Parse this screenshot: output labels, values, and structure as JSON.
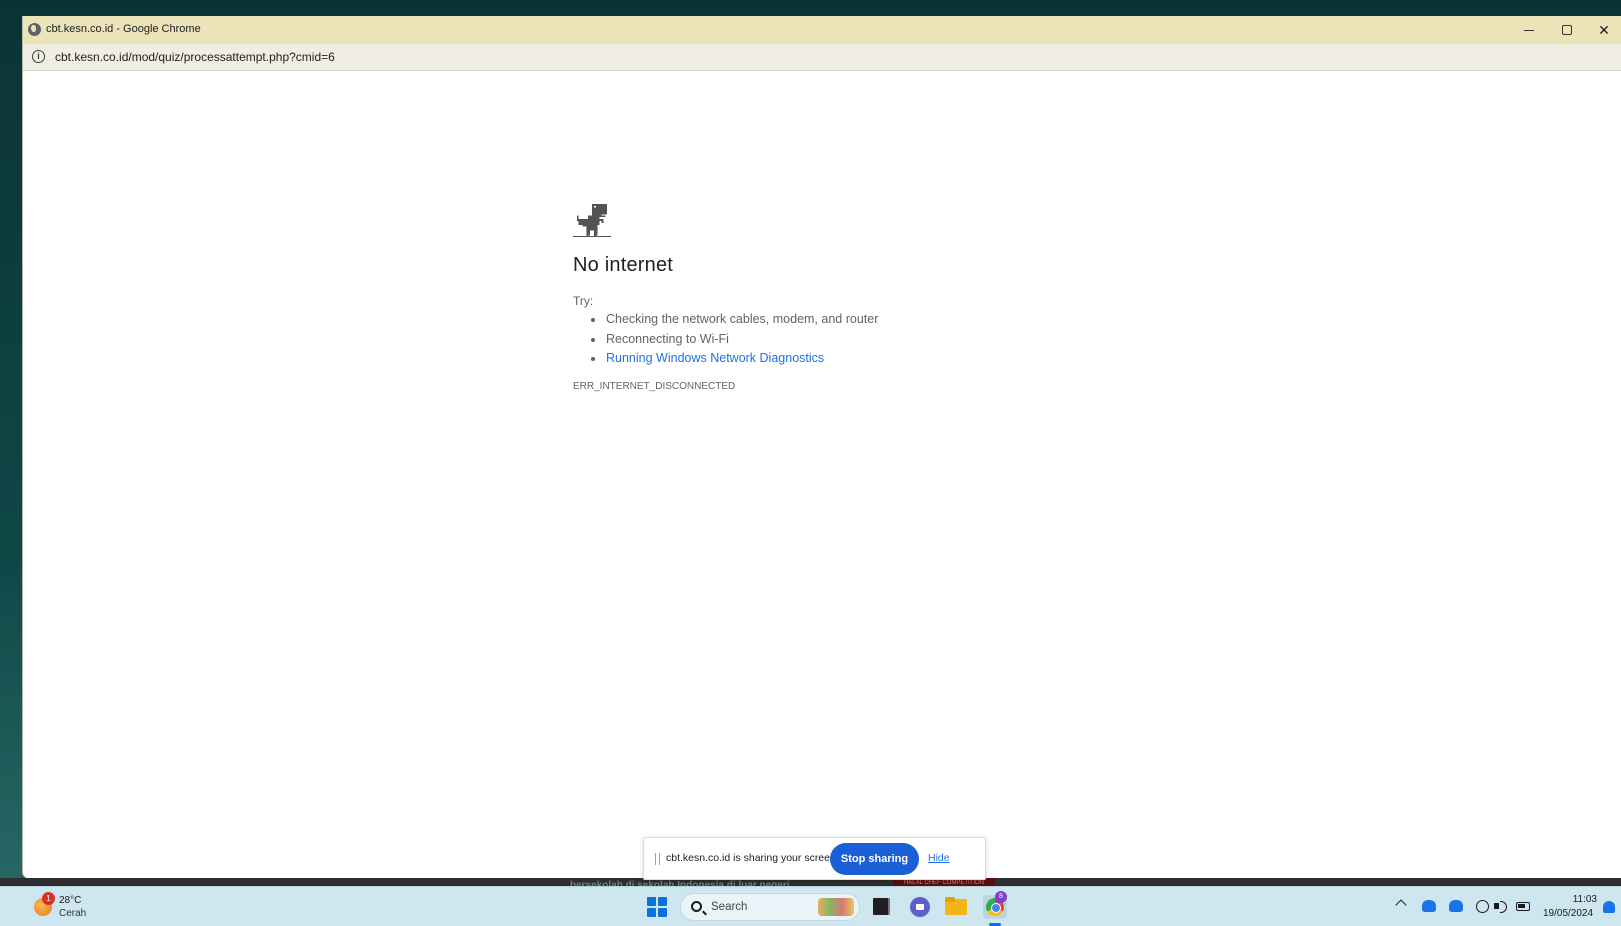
{
  "browser": {
    "window_title": "cbt.kesn.co.id - Google Chrome",
    "url": "cbt.kesn.co.id/mod/quiz/processattempt.php?cmid=6"
  },
  "error_page": {
    "title": "No internet",
    "try_label": "Try:",
    "suggestions": [
      "Checking the network cables, modem, and router",
      "Reconnecting to Wi-Fi",
      "Running Windows Network Diagnostics"
    ],
    "error_code": "ERR_INTERNET_DISCONNECTED",
    "icon": "dino-icon"
  },
  "share_bar": {
    "message": "cbt.kesn.co.id is sharing your screen.",
    "stop_label": "Stop sharing",
    "hide_label": "Hide"
  },
  "wallpaper": {
    "text": "bersekolah di sekolah Indonesia di luar negeri",
    "badge": "HALAL CHEF COMPETITION"
  },
  "taskbar": {
    "weather": {
      "temperature": "28°C",
      "condition": "Cerah",
      "badge": "1"
    },
    "search_placeholder": "Search",
    "chrome_badge": "8",
    "clock": {
      "time": "11:03",
      "date": "19/05/2024"
    }
  },
  "colors": {
    "titlebar": "#ece3b8",
    "link": "#1a73e8",
    "stop_button": "#1a5fd6",
    "taskbar": "#cde6ef"
  }
}
